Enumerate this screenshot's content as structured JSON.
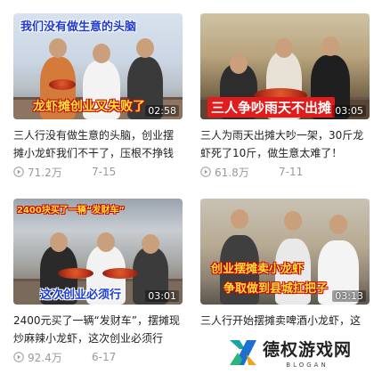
{
  "videos": [
    {
      "overlay_top": "我们没有做生意的头脑",
      "overlay_bottom": "龙虾摊创业又失败了",
      "duration": "02:58",
      "title": "三人行没有做生意的头脑，创业摆摊小龙虾我们不干了，压根不挣钱",
      "views": "71.2万",
      "date": "7-15"
    },
    {
      "overlay_bottom": "三人争吵雨天不出摊",
      "duration": "03:05",
      "title": "三人为雨天出摊大吵一架，30斤龙虾死了10斤，做生意太难了！",
      "views": "61.8万",
      "date": "7-11"
    },
    {
      "overlay_top": "2400块买了一辆“发财车”",
      "overlay_bottom": "这次创业必须行",
      "duration": "03:01",
      "title": "2400元买了一辆“发财车”，摆摊现炒麻辣小龙虾，这次创业必须行",
      "views": "92.4万",
      "date": "6-17"
    },
    {
      "overlay_mid": "创业摆摊卖小龙虾",
      "overlay_bottom": "争取做到县城扛把子",
      "duration": "03:13",
      "title": "三人行开始摆摊卖啤酒小龙虾，这"
    }
  ],
  "watermark": {
    "name": "德权游戏网",
    "sub": "BLOGAN"
  },
  "icons": {
    "play": "play-circle-icon"
  }
}
